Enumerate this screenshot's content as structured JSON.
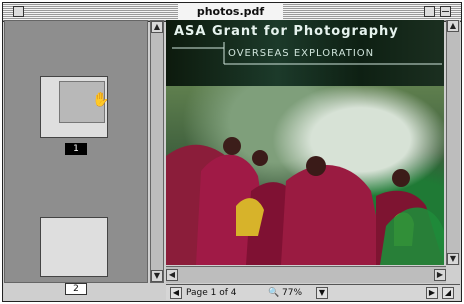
{
  "window": {
    "title": "photos.pdf"
  },
  "thumbnails": [
    {
      "page_label": "1"
    },
    {
      "page_label": "2"
    }
  ],
  "document": {
    "banner_title": "ASA Grant for Photography",
    "banner_subtitle": "OVERSEAS EXPLORATION"
  },
  "statusbar": {
    "page_label": "Page 1 of 4",
    "zoom_label": "77%"
  },
  "icons": {
    "close": "close-box-icon",
    "zoom": "zoom-box-icon",
    "shade": "collapse-box-icon",
    "hand": "hand-tool-icon",
    "magnifier": "magnifier-icon"
  }
}
